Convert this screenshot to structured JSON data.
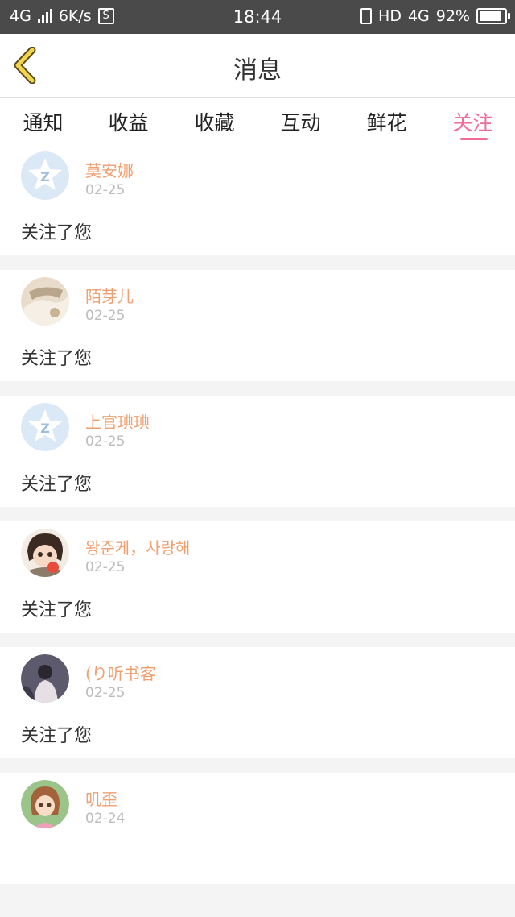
{
  "status_bar": {
    "network": "4G",
    "speed": "6K/s",
    "sim_badge": "S",
    "time": "18:44",
    "hd": "HD",
    "network_right": "4G",
    "battery": "92%",
    "battery_level": 0.92
  },
  "header": {
    "title": "消息",
    "back_icon": "chevron-left-icon"
  },
  "tabs": [
    {
      "label": "通知",
      "active": false
    },
    {
      "label": "收益",
      "active": false
    },
    {
      "label": "收藏",
      "active": false
    },
    {
      "label": "互动",
      "active": false
    },
    {
      "label": "鲜花",
      "active": false
    },
    {
      "label": "关注",
      "active": true
    }
  ],
  "colors": {
    "accent": "#f06a9a",
    "name": "#f0a070",
    "default_avatar": "#dbe8f5"
  },
  "messages": [
    {
      "name": "莫安娜",
      "date": "02-25",
      "text": "关注了您",
      "avatar": "default-avatar-icon"
    },
    {
      "name": "陌芽儿",
      "date": "02-25",
      "text": "关注了您",
      "avatar": "photo-avatar"
    },
    {
      "name": "上官琠琠",
      "date": "02-25",
      "text": "关注了您",
      "avatar": "default-avatar-icon"
    },
    {
      "name": "왕준케，사랑해",
      "date": "02-25",
      "text": "关注了您",
      "avatar": "photo-avatar"
    },
    {
      "name": "(り听书客",
      "date": "02-25",
      "text": "关注了您",
      "avatar": "photo-avatar"
    },
    {
      "name": "叽歪",
      "date": "02-24",
      "text": "",
      "avatar": "photo-avatar"
    }
  ]
}
